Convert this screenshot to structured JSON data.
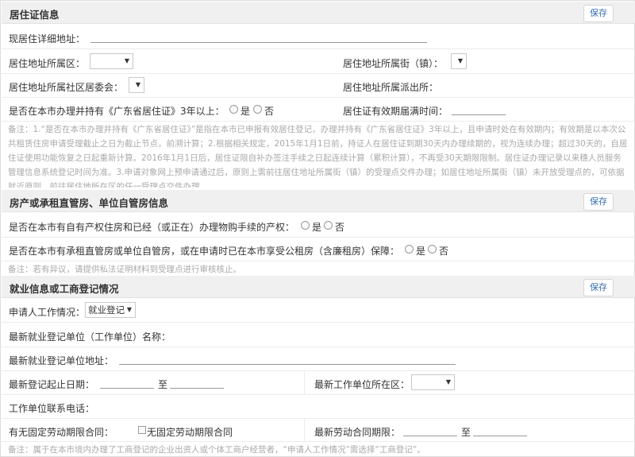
{
  "residence": {
    "title": "居住证信息",
    "save_label": "保存",
    "detail_address_label": "现居住详细地址：",
    "district_label": "居住地址所属区：",
    "street_label": "居住地址所属街（镇）：",
    "committee_label": "居住地址所属社区居委会：",
    "police_label": "居住地址所属派出所：",
    "permit_question": "是否在本市办理并持有《广东省居住证》3年以上：",
    "yes": "是",
    "no": "否",
    "valid_date_label": "居住证有效期届满时间：",
    "note": "备注：1.“是否在本市办理并持有《广东省居住证》”是指在本市已申报有效居住登记，办理并持有《广东省居住证》3年以上，且申请时处在有效期内；有效期是以本次公共租赁住房申请受理截止之日为截止节点，前溯计算；2.根据相关规定，2015年1月1日前，持证人在居住证到期30天内办理续期的，视为连续办理；超过30天的，自居住证使用功能恢复之日起重新计算。2016年1月1日后，居住证限自补办签注手续之日起连续计算（累积计算），不再受30天期限限制。居住证办理记录以来穗人员服务管理信息系统登记时间为准。3.申请对象网上预申请通过后，原则上需前往居住地址所属街（镇）的受理点交件办理；如居住地址所属街（镇）未开放受理点的，可依据就近原则，前往居住地所在区的任一受理点交件办理。"
  },
  "housing": {
    "title": "房产或承租直管房、单位自管房信息",
    "save_label": "保存",
    "q1": "是否在本市有自有产权住房和已经（或正在）办理物购手续的产权：",
    "q2": "是否在本市有承租直管房或单位自管房，或在申请时已在本市享受公租房（含廉租房）保障：",
    "yes": "是",
    "no": "否",
    "note": "备注：若有异议，请提供私法证明材料到受理点进行审核核止。"
  },
  "employment": {
    "title": "就业信息或工商登记情况",
    "save_label": "保存",
    "status_label": "申请人工作情况：",
    "status_value": "就业登记",
    "unit_name_label": "最新就业登记单位（工作单位）名称：",
    "unit_address_label": "最新就业登记单位地址：",
    "date_range_label": "最新登记起止日期：",
    "to_label": "至",
    "unit_district_label": "最新工作单位所在区：",
    "phone_label": "工作单位联系电话：",
    "contract_label": "有无固定劳动期限合同：",
    "contract_check_label": "无固定劳动期限合同",
    "contract_term_label": "最新劳动合同期限：",
    "note": "备注：属于在本市境内办理了工商登记的企业出资人或个体工商户经营者，“申请人工作情况”需选择“工商登记”。"
  }
}
